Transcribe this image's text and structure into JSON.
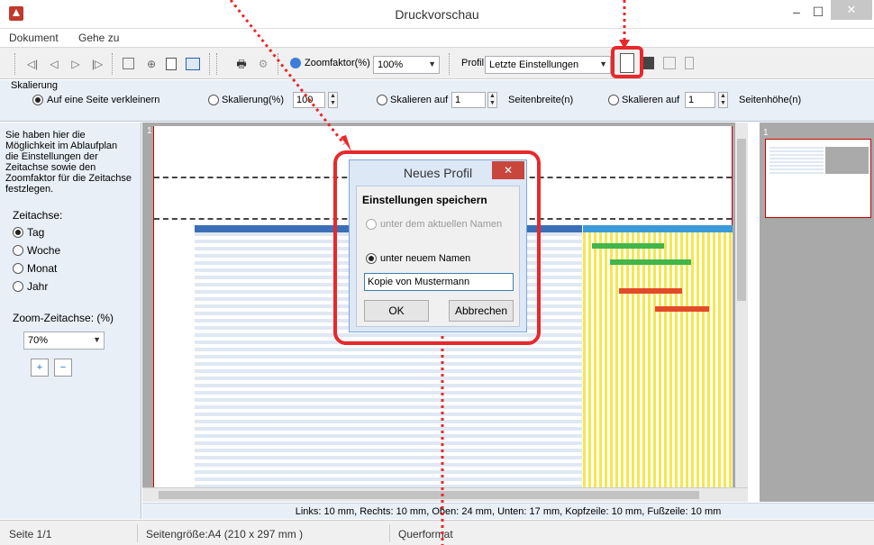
{
  "window": {
    "title": "Druckvorschau",
    "min": "–",
    "max": "☐",
    "close": "✕"
  },
  "menu": [
    "Dokument",
    "Gehe zu"
  ],
  "toolbar": {
    "zoom_label": "Zoomfaktor(%)",
    "zoom_value": "100%",
    "profile_label": "Profil:",
    "profile_value": "Letzte Einstellungen"
  },
  "scaling": {
    "group_label": "Skalierung",
    "fit_page": "Auf eine Seite verkleinern",
    "scale_pct": "Skalierung(%)",
    "scale_pct_value": "100",
    "scale_to": "Skalieren auf",
    "pages_wide_value": "1",
    "pages_wide_label": "Seitenbreite(n)",
    "scale_to2": "Skalieren auf",
    "pages_high_value": "1",
    "pages_high_label": "Seitenhöhe(n)"
  },
  "left": {
    "help": "Sie haben hier die Möglichkeit im Ablaufplan die Einstellungen der Zeitachse sowie den Zoomfaktor für die Zeitachse festzlegen.",
    "axis_label": "Zeitachse:",
    "options": [
      "Tag",
      "Woche",
      "Monat",
      "Jahr"
    ],
    "zoom_label": "Zoom-Zeitachse: (%)",
    "zoom_value": "70%"
  },
  "preview": {
    "page_number": "1",
    "thumb_number": "1"
  },
  "dialog": {
    "title": "Neues Profil",
    "heading": "Einstellungen speichern",
    "option_current": "unter dem aktuellen Namen",
    "option_new": "unter neuem Namen",
    "name_value": "Kopie von Mustermann",
    "ok": "OK",
    "cancel": "Abbrechen"
  },
  "margins": "Links: 10 mm, Rechts: 10 mm, Oben: 24 mm, Unten: 17 mm, Kopfzeile: 10 mm, Fußzeile: 10 mm",
  "status": {
    "page": "Seite 1/1",
    "size": "Seitengröße:A4 (210 x 297 mm )",
    "orientation": "Querformat"
  },
  "colors": {
    "accent": "#e8282b",
    "panel": "#e8eff7",
    "dialog": "#dce8f6"
  }
}
